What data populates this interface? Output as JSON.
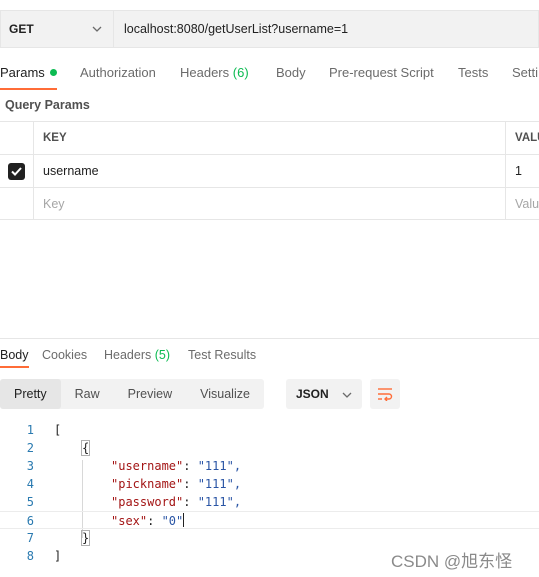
{
  "request": {
    "method": "GET",
    "url": "localhost:8080/getUserList?username=1"
  },
  "request_tabs": [
    {
      "label": "Params",
      "active": true
    },
    {
      "label": "Authorization"
    },
    {
      "label": "Headers",
      "count": "(6)"
    },
    {
      "label": "Body"
    },
    {
      "label": "Pre-request Script"
    },
    {
      "label": "Tests"
    },
    {
      "label": "Setti"
    }
  ],
  "query_params": {
    "title": "Query Params",
    "columns": [
      "KEY",
      "VALU"
    ],
    "rows": [
      {
        "key": "username",
        "value": "1",
        "checked": true
      }
    ],
    "placeholder": {
      "key": "Key",
      "value": "Valu"
    }
  },
  "response_tabs": [
    {
      "label": "Body",
      "active": true
    },
    {
      "label": "Cookies"
    },
    {
      "label": "Headers",
      "count": "(5)"
    },
    {
      "label": "Test Results"
    }
  ],
  "view_modes": [
    "Pretty",
    "Raw",
    "Preview",
    "Visualize"
  ],
  "format": "JSON",
  "code_lines": [
    {
      "n": "1",
      "text": "["
    },
    {
      "n": "2",
      "text": "{"
    },
    {
      "n": "3",
      "key": "\"username\"",
      "val": "\"111\","
    },
    {
      "n": "4",
      "key": "\"pickname\"",
      "val": "\"111\","
    },
    {
      "n": "5",
      "key": "\"password\"",
      "val": "\"111\","
    },
    {
      "n": "6",
      "key": "\"sex\"",
      "val": "\"0\""
    },
    {
      "n": "7",
      "text": "}"
    },
    {
      "n": "8",
      "text": "]"
    }
  ],
  "watermark": "CSDN @旭东怪",
  "colors": {
    "accent": "#ff6c37",
    "green": "#0cbb52"
  }
}
